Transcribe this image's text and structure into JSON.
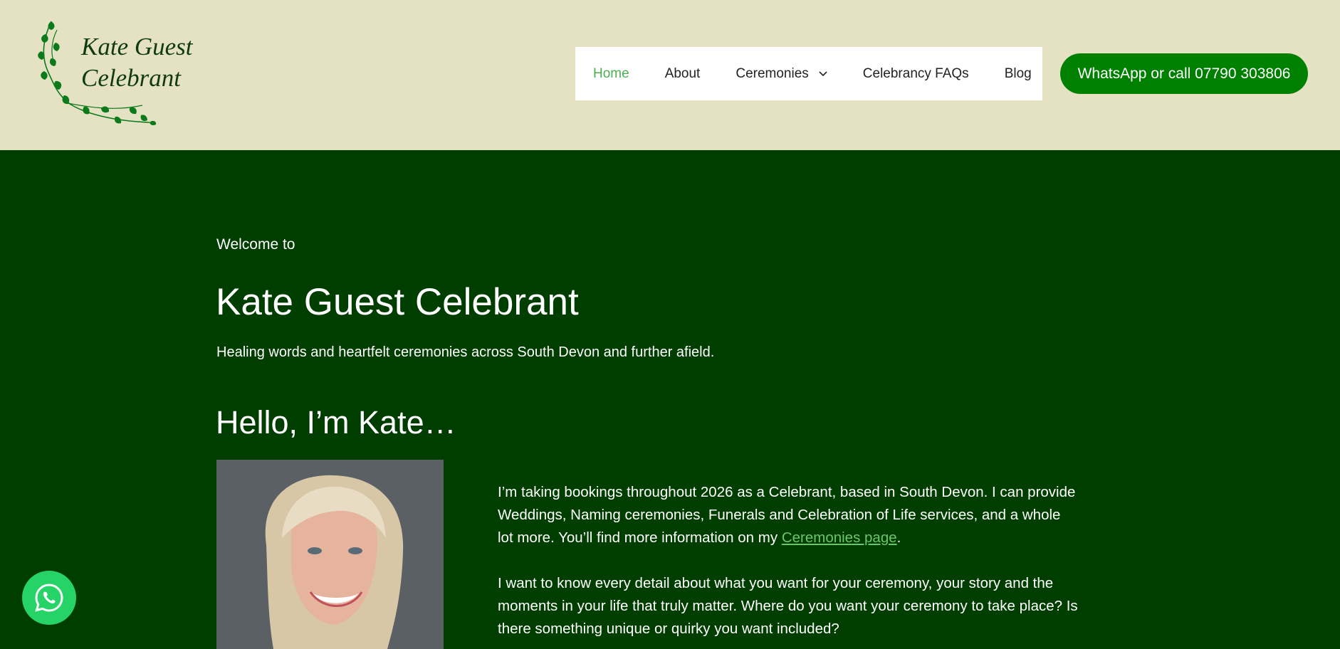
{
  "header": {
    "logo": {
      "line1": "Kate Guest",
      "line2": "Celebrant",
      "icon": "vine-leaves-logo"
    },
    "nav": [
      {
        "label": "Home",
        "active": true
      },
      {
        "label": "About"
      },
      {
        "label": "Ceremonies",
        "has_dropdown": true,
        "icon": "chevron-down-icon"
      },
      {
        "label": "Celebrancy FAQs"
      },
      {
        "label": "Blog"
      }
    ],
    "cta_label": "WhatsApp or call 07790 303806"
  },
  "hero": {
    "welcome": "Welcome to",
    "title": "Kate Guest Celebrant",
    "subtitle": "Healing words and heartfelt ceremonies across South Devon and further afield.",
    "hello": "Hello, I’m Kate…"
  },
  "intro": {
    "p1_before": "I’m taking bookings throughout 2026 as a Celebrant, based in South Devon. I can provide Weddings, Naming ceremonies, Funerals and Celebration of Life services, and a whole lot more. You’ll find more information on my ",
    "p1_link": "Ceremonies page",
    "p1_after": ".",
    "p2": "I want to know every detail about what you want for your ceremony, your story and the moments in your life that truly matter. Where do you want your ceremony to take place? Is there something unique or quirky you want included?"
  },
  "floating": {
    "icon": "whatsapp-icon"
  },
  "colors": {
    "header_bg": "#e5e2c4",
    "page_bg": "#003e00",
    "accent_green": "#008000",
    "link_green": "#6cc46c",
    "whatsapp_green": "#25d366"
  }
}
